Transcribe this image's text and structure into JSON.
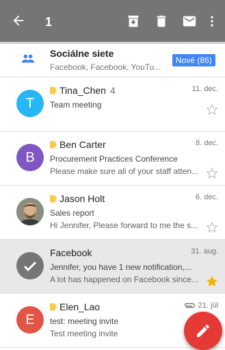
{
  "toolbar": {
    "selected_count": "1",
    "back_icon": "arrow-back-icon",
    "archive_icon": "archive-icon",
    "delete_icon": "trash-icon",
    "mark_icon": "mail-icon",
    "more_icon": "more-vert-icon"
  },
  "promo": {
    "title": "Sociálne siete",
    "subtitle": "Facebook, Facebook, YouTu...",
    "badge": "Nové (86)",
    "icon": "people-icon"
  },
  "emails": [
    {
      "avatar_letter": "T",
      "avatar_color": "#29b6f6",
      "sender": "Tina_Chen",
      "count": "4",
      "date": "11. dec.",
      "subject": "Team meeting",
      "snippet": "",
      "starred": false,
      "important": true
    },
    {
      "avatar_letter": "B",
      "avatar_color": "#7e57c2",
      "sender": "Ben Carter",
      "count": "",
      "date": "8. dec.",
      "subject": "Procurement Practices Conference",
      "snippet": "Please make sure all of your staff atten...",
      "starred": false,
      "important": true
    },
    {
      "avatar_letter": "",
      "avatar_color": "#6e7b6b",
      "sender": "Jason Holt",
      "count": "",
      "date": "6. dec.",
      "subject": "Sales report",
      "snippet": "Hi Jennifer, Please forward to me the s...",
      "starred": false,
      "important": true
    },
    {
      "avatar_letter": "",
      "avatar_color": "#757575",
      "sender": "Facebook",
      "count": "",
      "date": "31. aug.",
      "subject": "Jennifer, you have 1 new notification,...",
      "snippet": "A lot has happened on Facebook since...",
      "starred": true,
      "important": false
    },
    {
      "avatar_letter": "E",
      "avatar_color": "#e05545",
      "sender": "Elen_Lao",
      "count": "",
      "date": "21. júl",
      "subject": "test: meeting invite",
      "snippet": "Test meeting invite",
      "starred": false,
      "important": true
    }
  ],
  "colors": {
    "accent": "#4285f4",
    "appbar": "#757575",
    "fab": "#e53935",
    "star": "#f4b400"
  },
  "fab": {
    "icon": "pencil-icon"
  }
}
